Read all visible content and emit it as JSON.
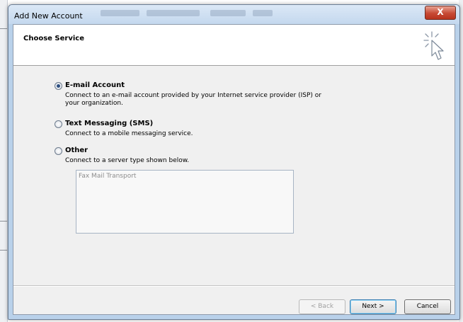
{
  "window": {
    "title": "Add New Account",
    "close_label": "X"
  },
  "header": {
    "title": "Choose Service",
    "icon": "cursor-click-icon"
  },
  "options": [
    {
      "label": "E-mail Account",
      "desc_line1": "Connect to an e-mail account provided by your Internet service provider (ISP) or",
      "desc_line2": "your organization.",
      "selected": true
    },
    {
      "label": "Text Messaging (SMS)",
      "desc_line1": "Connect to a mobile messaging service.",
      "selected": false
    },
    {
      "label": "Other",
      "desc_line1": "Connect to a server type shown below.",
      "selected": false
    }
  ],
  "server_list": {
    "items": [
      "Fax Mail Transport"
    ]
  },
  "buttons": {
    "back": "< Back",
    "next": "Next >",
    "cancel": "Cancel"
  },
  "colors": {
    "selection": "#2c4e80",
    "window_frame": "#b9d1ea",
    "close": "#c74a34"
  }
}
